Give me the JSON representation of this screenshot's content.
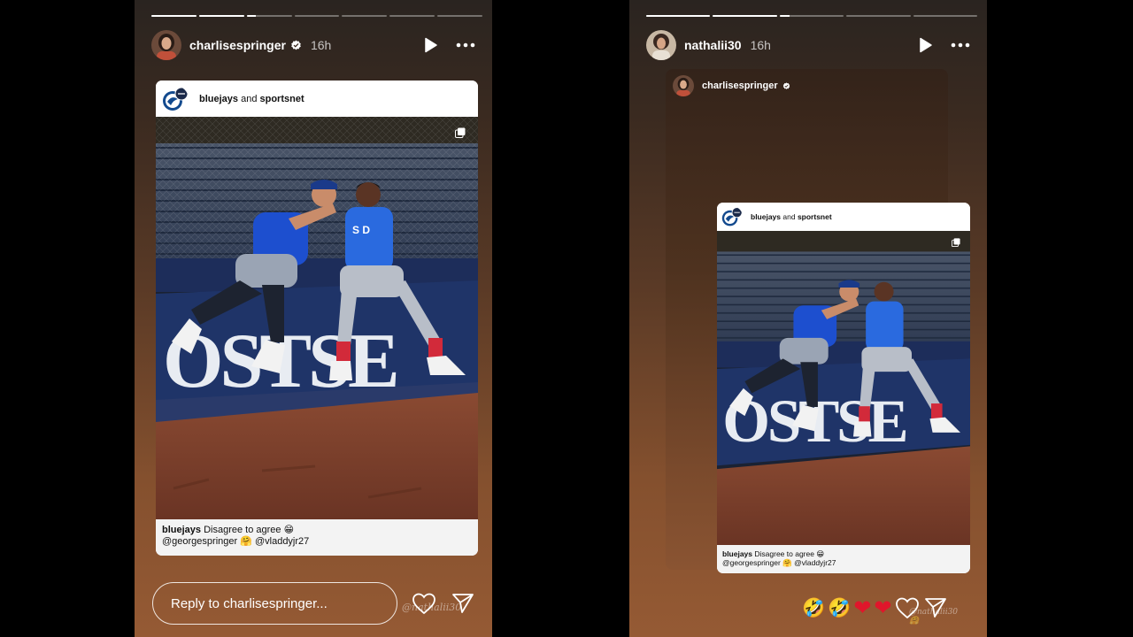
{
  "left_story": {
    "progress": [
      1,
      1,
      0.2,
      0,
      0,
      0,
      0
    ],
    "username": "charlisespringer",
    "verified": true,
    "time": "16h",
    "post": {
      "account_line_bold_1": "bluejays",
      "account_line_and": " and ",
      "account_line_bold_2": "sportsnet",
      "caption_user": "bluejays",
      "caption_text": " Disagree to agree 😁",
      "caption_line2": "@georgespringer 🤗 @vladdyjr27"
    },
    "mention": "@nathalii30",
    "reply_placeholder": "Reply to charlisespringer...",
    "icons": {
      "play": "play-icon",
      "more": "more-icon",
      "like": "heart-icon",
      "share": "send-icon"
    }
  },
  "right_story": {
    "progress": [
      1,
      1,
      0.15,
      0,
      0
    ],
    "username": "nathalii30",
    "time": "16h",
    "reshared_from": "charlisespringer",
    "reshared_verified": true,
    "post": {
      "account_line_bold_1": "bluejays",
      "account_line_and": " and ",
      "account_line_bold_2": "sportsnet",
      "caption_user": "bluejays",
      "caption_text": " Disagree to agree 😁",
      "caption_line2": "@georgespringer 🤗 @vladdyjr27"
    },
    "mention": "@nathalii30 🤗",
    "reactions": [
      "🤣",
      "🤣",
      "❤",
      "❤"
    ],
    "icons": {
      "play": "play-icon",
      "more": "more-icon",
      "like": "heart-icon",
      "share": "send-icon"
    }
  },
  "colors": {
    "brand_blue": "#134a8e",
    "verified_blue": "#ffffff",
    "heart_red": "#e0162b"
  }
}
